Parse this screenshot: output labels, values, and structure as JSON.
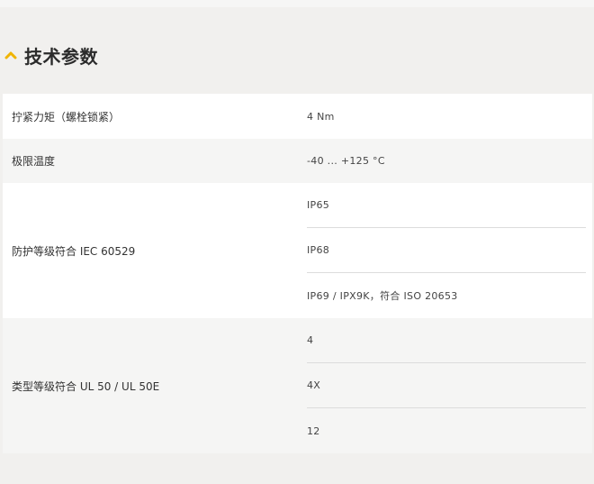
{
  "section": {
    "title": "技术参数",
    "icon": "chevron-up-icon",
    "accent_color": "#f0b400"
  },
  "rows": [
    {
      "label": "拧紧力矩（螺栓锁紧）",
      "values": [
        "4 Nm"
      ]
    },
    {
      "label": "极限温度",
      "values": [
        "-40 ... +125 °C"
      ]
    },
    {
      "label": "防护等级符合 IEC 60529",
      "values": [
        "IP65",
        "IP68",
        "IP69 / IPX9K，符合 ISO 20653"
      ]
    },
    {
      "label": "类型等级符合 UL 50 / UL 50E",
      "values": [
        "4",
        "4X",
        "12"
      ]
    }
  ]
}
